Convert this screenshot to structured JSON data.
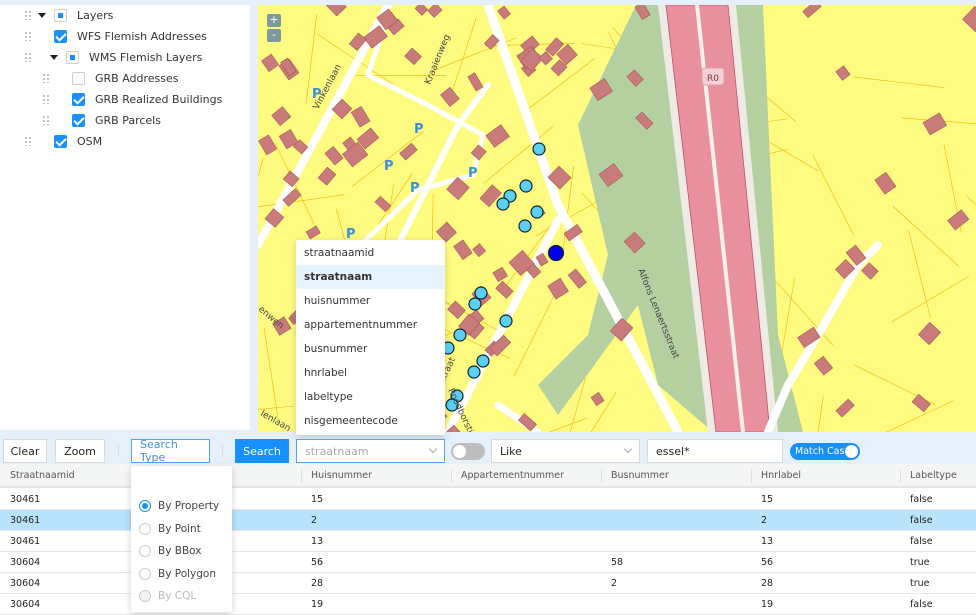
{
  "layers": {
    "root": "Layers",
    "wfs": "WFS Flemish Addresses",
    "wms": "WMS Flemish Layers",
    "grb_addresses": "GRB Addresses",
    "grb_buildings": "GRB Realized Buildings",
    "grb_parcels": "GRB Parcels",
    "osm": "OSM"
  },
  "map": {
    "zoom_in": "+",
    "zoom_out": "-",
    "labels": {
      "road_shield": "R0",
      "vinkenlaan": "Vinkenlaan",
      "kraaienweg": "Kraaienweg",
      "alfons": "Alfons Lenaertsstraat",
      "roodborst": "Roodborstje",
      "straat": "straat",
      "enwen": "enwen",
      "lenlaan": "lenlaan",
      "parking": "P"
    },
    "colors": {
      "land": "#fffb80",
      "building": "#c97b7b",
      "highway": "#e8909c",
      "green": "#b4d0a0",
      "marker": "#5bd0f5",
      "selected_marker": "#0000ee"
    }
  },
  "toolbar": {
    "clear": "Clear",
    "zoom": "Zoom",
    "search_type": "Search Type",
    "search": "Search",
    "field_value": "straatnaam",
    "operator_value": "Like",
    "query_value": "essel*",
    "match_case": "Match Case"
  },
  "field_options": [
    "straatnaamid",
    "straatnaam",
    "huisnummer",
    "appartementnummer",
    "busnummer",
    "hnrlabel",
    "labeltype",
    "nisgemeentecode"
  ],
  "search_types": [
    "By Property",
    "By Point",
    "By BBox",
    "By Polygon",
    "By CQL"
  ],
  "table": {
    "columns": [
      "Straatnaamid",
      "Huisnummer",
      "Appartementnummer",
      "Busnummer",
      "Hnrlabel",
      "Labeltype"
    ],
    "rows": [
      [
        "30461",
        "15",
        "",
        "",
        "15",
        "false"
      ],
      [
        "30461",
        "2",
        "",
        "",
        "2",
        "false"
      ],
      [
        "30461",
        "13",
        "",
        "",
        "13",
        "false"
      ],
      [
        "30604",
        "56",
        "",
        "58",
        "56",
        "true"
      ],
      [
        "30604",
        "28",
        "",
        "2",
        "28",
        "true"
      ],
      [
        "30604",
        "19",
        "",
        "",
        "19",
        "false"
      ]
    ]
  }
}
